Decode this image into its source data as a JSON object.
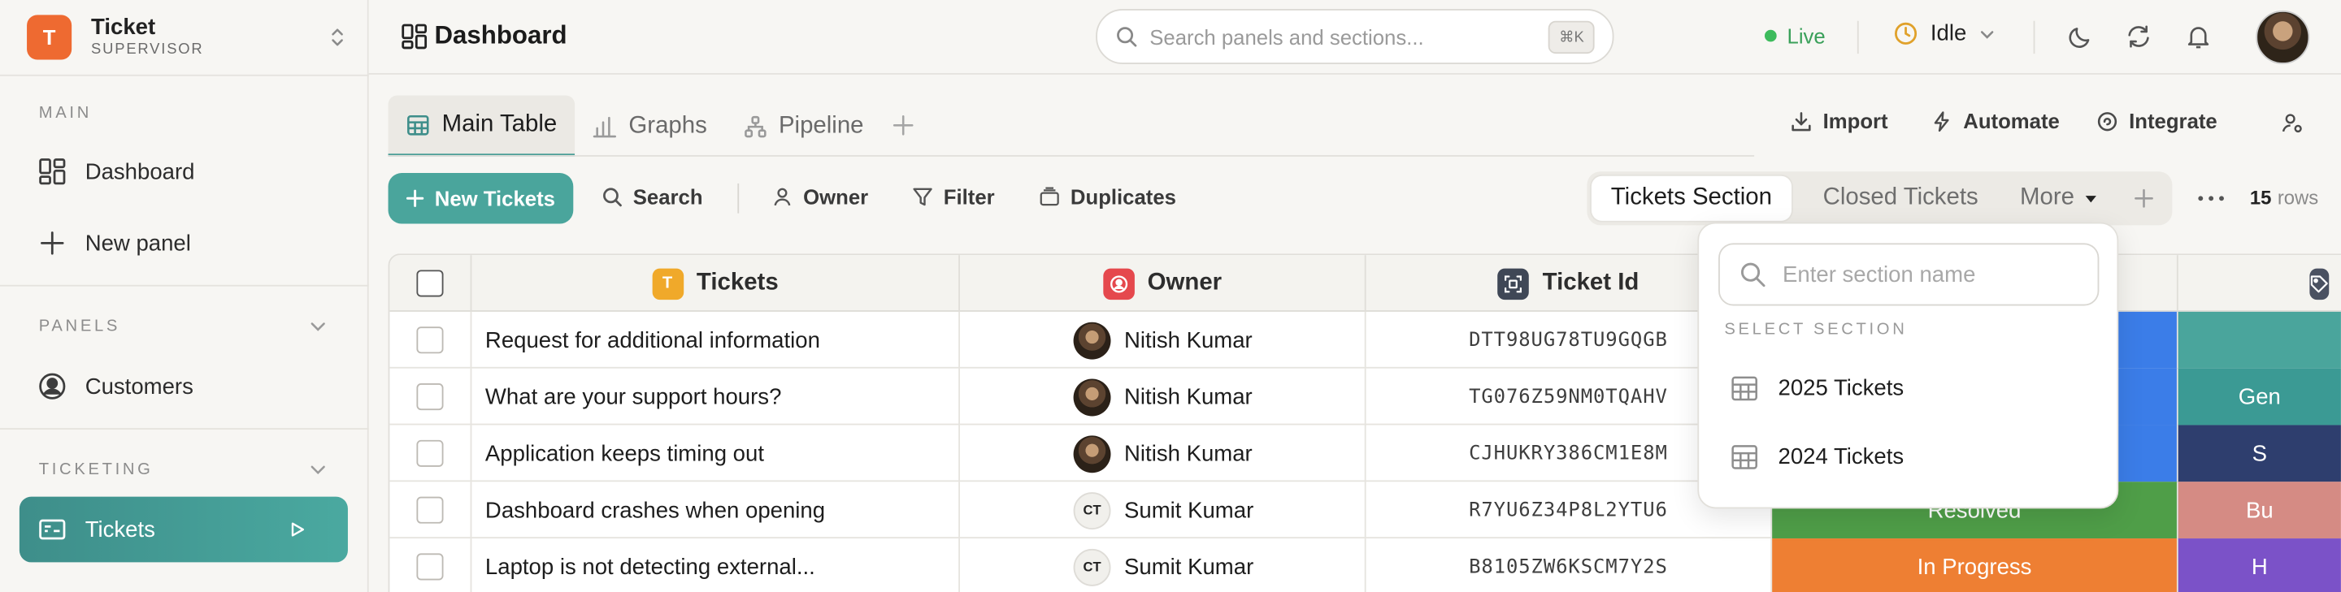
{
  "brand": {
    "logo_letter": "T",
    "title": "Ticket",
    "subtitle": "SUPERVISOR"
  },
  "sidebar": {
    "main_label": "MAIN",
    "dashboard": "Dashboard",
    "new_panel": "New panel",
    "panels_label": "PANELS",
    "customers": "Customers",
    "ticketing_label": "TICKETING",
    "tickets": "Tickets"
  },
  "header": {
    "title": "Dashboard",
    "search_placeholder": "Search panels and sections...",
    "shortcut": "⌘K",
    "live": "Live",
    "status": "Idle"
  },
  "tabs": {
    "main_table": "Main Table",
    "graphs": "Graphs",
    "pipeline": "Pipeline"
  },
  "actions": {
    "import": "Import",
    "automate": "Automate",
    "integrate": "Integrate"
  },
  "toolbar": {
    "new_tickets": "New Tickets",
    "search": "Search",
    "owner": "Owner",
    "filter": "Filter",
    "duplicates": "Duplicates",
    "section_tabs": [
      "Tickets Section",
      "Closed Tickets",
      "More"
    ],
    "rows_count": "15",
    "rows_label": "rows"
  },
  "table": {
    "columns": [
      {
        "label": "Tickets",
        "icon_letter": "T",
        "color": "#f0a92a"
      },
      {
        "label": "Owner",
        "color": "#e5484d"
      },
      {
        "label": "Ticket Id",
        "color": "#3f4756"
      }
    ],
    "rows": [
      {
        "ticket": "Request for additional information",
        "owner": "Nitish Kumar",
        "avatar": "photo",
        "id": "DTT98UG78TU9GQGB",
        "status": "",
        "status_color": "#3b7de8",
        "tag": "",
        "tag_color": "#4aa59c"
      },
      {
        "ticket": "What are your support hours?",
        "owner": "Nitish Kumar",
        "avatar": "photo",
        "id": "TG076Z59NM0TQAHV",
        "status": "",
        "status_color": "#3b7de8",
        "tag": "Gen",
        "tag_color": "#3b9a94"
      },
      {
        "ticket": "Application keeps timing out",
        "owner": "Nitish Kumar",
        "avatar": "photo",
        "id": "CJHUKRY386CM1E8M",
        "status": "",
        "status_color": "#3b7de8",
        "tag": "S",
        "tag_color": "#2e3e6e"
      },
      {
        "ticket": "Dashboard crashes when opening",
        "owner": "Sumit Kumar",
        "avatar": "CT",
        "id": "R7YU6Z34P8L2YTU6",
        "status": "Resolved",
        "status_color": "#4f9e48",
        "tag": "Bu",
        "tag_color": "#d58b84"
      },
      {
        "ticket": "Laptop is not detecting external...",
        "owner": "Sumit Kumar",
        "avatar": "CT",
        "id": "B8105ZW6KSCM7Y2S",
        "status": "In Progress",
        "status_color": "#ee7f33",
        "tag": "H",
        "tag_color": "#7b52c8"
      }
    ]
  },
  "dropdown": {
    "placeholder": "Enter section name",
    "label": "SELECT SECTION",
    "items": [
      "2025 Tickets",
      "2024 Tickets"
    ]
  }
}
